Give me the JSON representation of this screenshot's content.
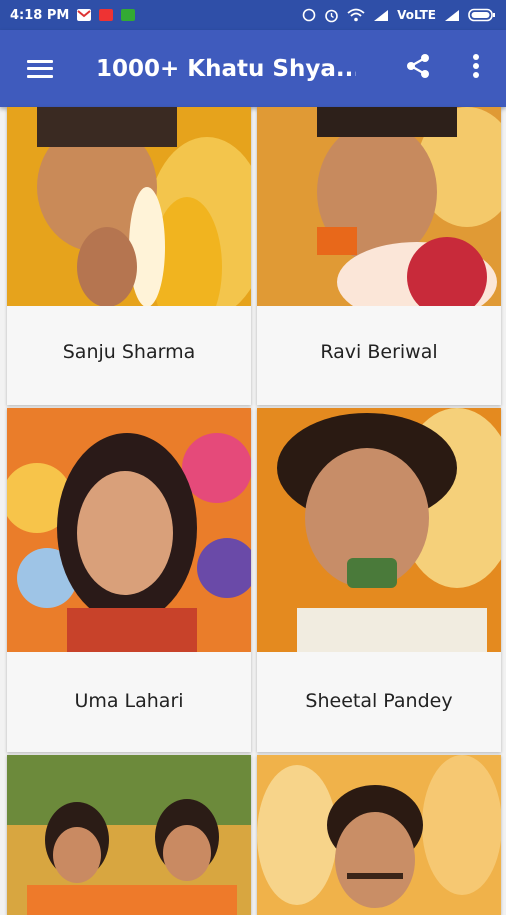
{
  "status_bar": {
    "time": "4:18 PM",
    "network": "VoLTE",
    "icons": [
      "gmail-icon",
      "app-icon-red",
      "app-icon-green",
      "data-saver-icon",
      "alarm-icon",
      "wifi-icon",
      "signal-icon",
      "battery-icon"
    ]
  },
  "app_bar": {
    "title": "1000+ Khatu Shya...",
    "icons": [
      "menu-icon",
      "share-icon",
      "more-vert-icon"
    ]
  },
  "singers": [
    {
      "name": "Sanju Sharma",
      "photo_colors": [
        "#e4a51b",
        "#f3c14a",
        "#b86a14"
      ]
    },
    {
      "name": "Ravi Beriwal",
      "photo_colors": [
        "#d88a2a",
        "#f1be63",
        "#7d3e1c"
      ]
    },
    {
      "name": "Uma Lahari",
      "photo_colors": [
        "#e5722b",
        "#f4c043",
        "#5a2a2a"
      ]
    },
    {
      "name": "Sheetal Pandey",
      "photo_colors": [
        "#e48b1f",
        "#f5c867",
        "#3a2414"
      ]
    },
    {
      "name": "",
      "photo_colors": [
        "#e99a24",
        "#5b8a3b",
        "#2f2420"
      ]
    },
    {
      "name": "",
      "photo_colors": [
        "#f0b24a",
        "#f7d48a",
        "#2b1a12"
      ]
    }
  ],
  "colors": {
    "status_bar": "#2f4fa8",
    "app_bar": "#3f5bbd",
    "background": "#f2f2f2"
  }
}
